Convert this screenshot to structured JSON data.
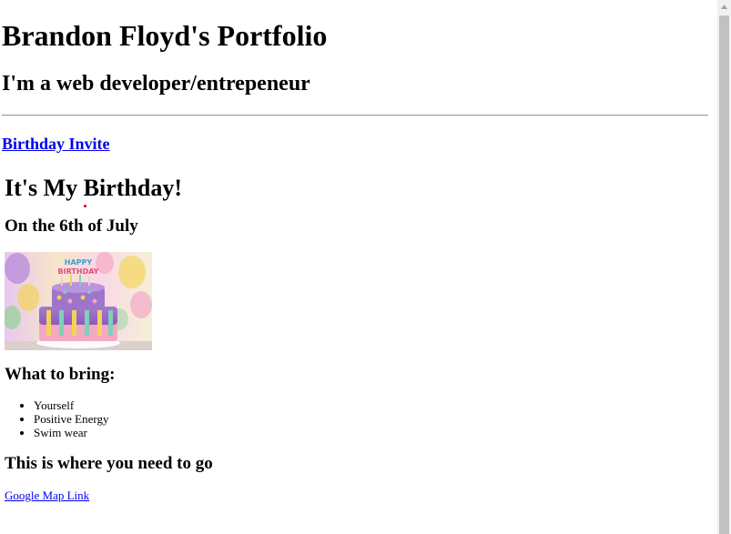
{
  "header": {
    "title": "Brandon Floyd's Portfolio",
    "tagline": "I'm a web developer/entrepeneur"
  },
  "nav": {
    "invite_link": "Birthday Invite"
  },
  "invite": {
    "title": "It's My Birthday!",
    "date": "On the 6th of July",
    "image": {
      "alt": "birthday cake",
      "banner_text": "HAPPY BIRTHDAY"
    },
    "bring_title": "What to bring:",
    "bring_items": [
      "Yourself",
      "Positive Energy",
      "Swim wear"
    ],
    "location_title": "This is where you need to go",
    "map_link": "Google Map Link"
  },
  "colors": {
    "link": "#0000ee",
    "text": "#000000",
    "scrollbar_track": "#f1f1f1",
    "scrollbar_thumb": "#c1c1c1"
  }
}
